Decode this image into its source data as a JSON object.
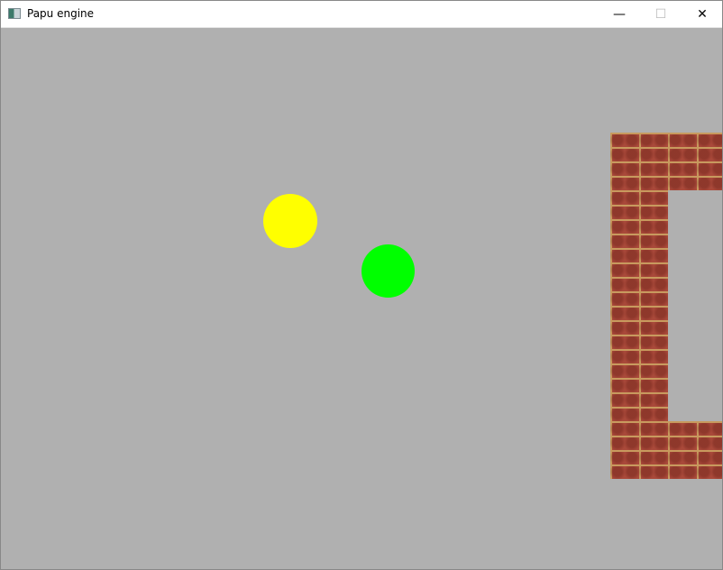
{
  "window": {
    "title": "Papu engine",
    "app_icon": "window-app-icon",
    "controls": {
      "minimize": "—",
      "maximize": "☐",
      "close": "✕"
    }
  },
  "scene": {
    "background_color": "#b0b0b0",
    "entities": [
      {
        "type": "ball",
        "color": "#ffff00"
      },
      {
        "type": "ball",
        "color": "#00ff00"
      }
    ],
    "wall_texture": "brick",
    "brick_color": "#a9493a",
    "mortar_color": "#c89a5e"
  }
}
